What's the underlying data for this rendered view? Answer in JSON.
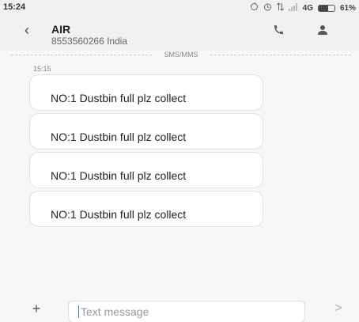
{
  "status_bar": {
    "time": "15:24",
    "network": "4G",
    "battery_percent_label": "61%",
    "battery_level": 0.61,
    "icons": [
      "sync-icon",
      "alarm-icon",
      "data-transfer-icon",
      "signal-icon",
      "battery-icon"
    ]
  },
  "header": {
    "contact_name": "AIR",
    "contact_subtitle": "8553560266 India",
    "back_icon": "chevron-left-icon",
    "call_icon": "phone-icon",
    "profile_icon": "person-icon"
  },
  "thread": {
    "divider_label": "SMS/MMS",
    "time_label": "15:15",
    "messages": [
      {
        "text": "NO:1 Dustbin full plz collect"
      },
      {
        "text": "NO:1 Dustbin full plz collect"
      },
      {
        "text": "NO:1 Dustbin full plz collect"
      },
      {
        "text": "NO:1 Dustbin full plz collect"
      }
    ]
  },
  "composer": {
    "add_icon": "plus-icon",
    "input_placeholder": "Text message",
    "send_icon": "send-icon"
  },
  "colors": {
    "background": "#f7f7f7",
    "bubble": "#ffffff",
    "accent_cursor": "#1e88ff"
  }
}
